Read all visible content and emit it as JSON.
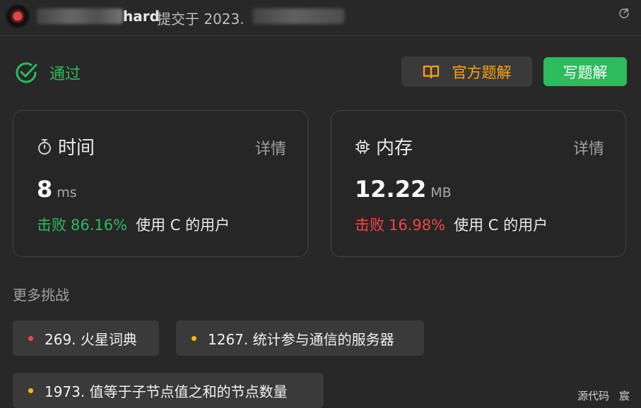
{
  "header": {
    "username_tail": "hard",
    "submitted_text": "提交于 2023."
  },
  "status": {
    "label": "通过",
    "color": "#2cbb5d"
  },
  "buttons": {
    "official_solution": "官方题解",
    "write_solution": "写题解"
  },
  "cards": {
    "time": {
      "title": "时间",
      "detail": "详情",
      "value": "8",
      "unit": "ms",
      "beat_label": "击败",
      "beat_percent": "86.16%",
      "rest": "使用 C 的用户"
    },
    "memory": {
      "title": "内存",
      "detail": "详情",
      "value": "12.22",
      "unit": "MB",
      "beat_label": "击败",
      "beat_percent": "16.98%",
      "rest": "使用 C 的用户"
    }
  },
  "more": {
    "title": "更多挑战",
    "items": [
      {
        "label": "269. 火星词典",
        "difficulty_color": "#ef4743"
      },
      {
        "label": "1267. 统计参与通信的服务器",
        "difficulty_color": "#ffb800"
      },
      {
        "label": "1973. 值等于子节点值之和的节点数量",
        "difficulty_color": "#ffb800"
      }
    ]
  },
  "footer": {
    "source_code": "源代码",
    "author": "宸"
  },
  "icons": {
    "avatar": "avatar-image",
    "share": "share-icon",
    "status": "check-circle-icon",
    "book": "book-icon",
    "time": "stopwatch-icon",
    "memory": "chip-icon"
  },
  "colors": {
    "accent_green": "#2cbb5d",
    "accent_orange": "#ffa116",
    "red": "#ef4743",
    "yellow": "#ffb800"
  }
}
